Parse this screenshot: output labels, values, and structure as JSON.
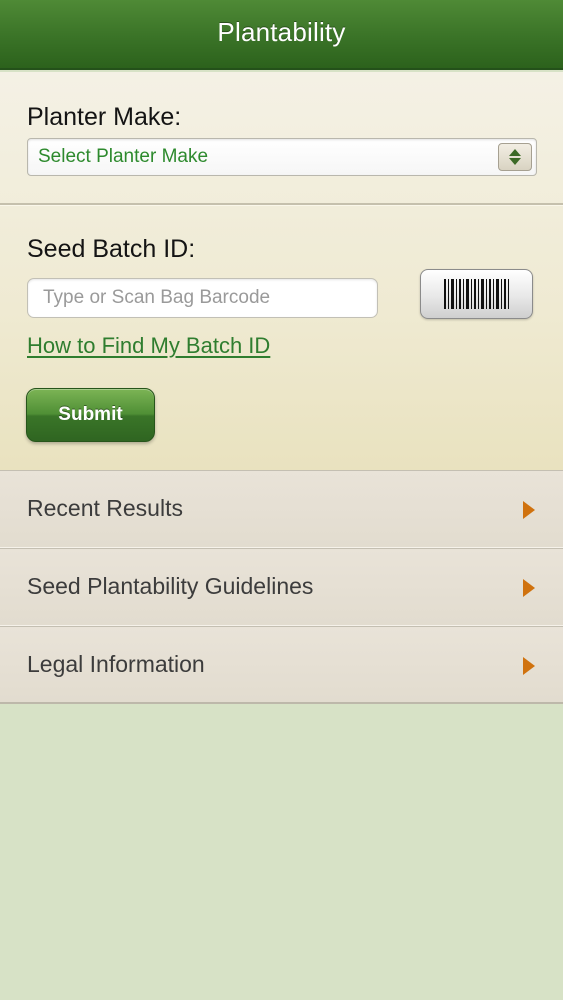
{
  "nav": {
    "title": "Plantability"
  },
  "form": {
    "planter_label": "Planter Make:",
    "planter_select_value": "Select Planter Make",
    "seed_label": "Seed Batch ID:",
    "barcode_placeholder": "Type or Scan Bag Barcode",
    "barcode_value": "",
    "help_link": "How to Find My Batch ID",
    "submit_label": "Submit"
  },
  "menu": {
    "items": [
      {
        "label": "Recent Results",
        "icon": "chevron-right-icon"
      },
      {
        "label": "Seed Plantability Guidelines",
        "icon": "chevron-right-icon"
      },
      {
        "label": "Legal Information",
        "icon": "chevron-right-icon"
      }
    ]
  },
  "colors": {
    "nav_green": "#3a7327",
    "accent_green": "#2f7d2f",
    "arrow_orange": "#d0720e",
    "background": "#d7e2c6"
  },
  "icons": {
    "select": "updown-arrows-icon",
    "scan": "barcode-icon"
  }
}
